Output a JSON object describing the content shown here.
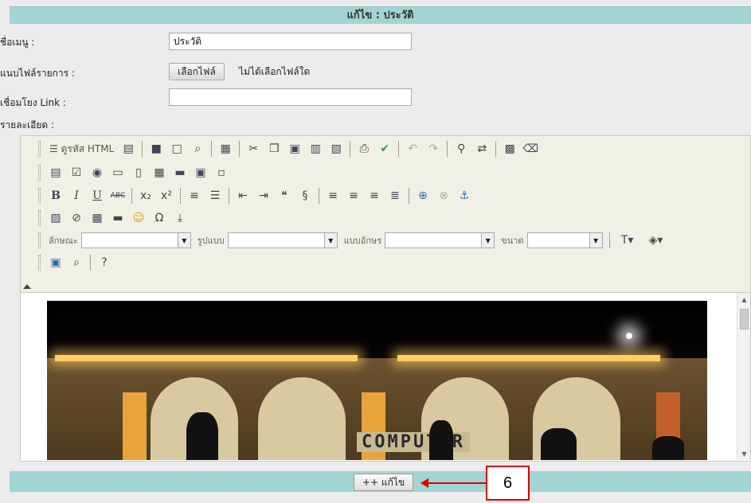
{
  "form": {
    "title": "แก้ไข : ประวัติ",
    "menu_name_label": "ชื่อเมนู :",
    "menu_name_value": "ประวัติ",
    "attach_label": "แนบไฟล์รายการ :",
    "file_button_label": "เลือกไฟล์",
    "file_status": "ไม่ได้เลือกไฟล์ใด",
    "link_label": "เชื่อมโยง Link :",
    "link_value": "",
    "detail_label": "รายละเอียด :"
  },
  "toolbar": {
    "source_label": "ดูรหัส HTML",
    "style_label": "ลักษณะ",
    "format_label": "รูปแบบ",
    "font_label": "แบบอักษร",
    "size_label": "ขนาด",
    "bold_label": "B",
    "italic_label": "I",
    "underline_label": "U",
    "strike_label": "ABC",
    "style_value": "",
    "format_value": "",
    "font_value": "",
    "size_value": ""
  },
  "editor": {
    "photo_sign_text": "COMPUTER"
  },
  "footer": {
    "submit_label": "++ แก้ไข"
  },
  "annotation": {
    "callout_number": "6",
    "callout_color": "#e00000"
  },
  "colors": {
    "header_bar": "#a3d4d4",
    "panel_bg": "#ececec",
    "toolbar_bg": "#f0f0e4"
  }
}
